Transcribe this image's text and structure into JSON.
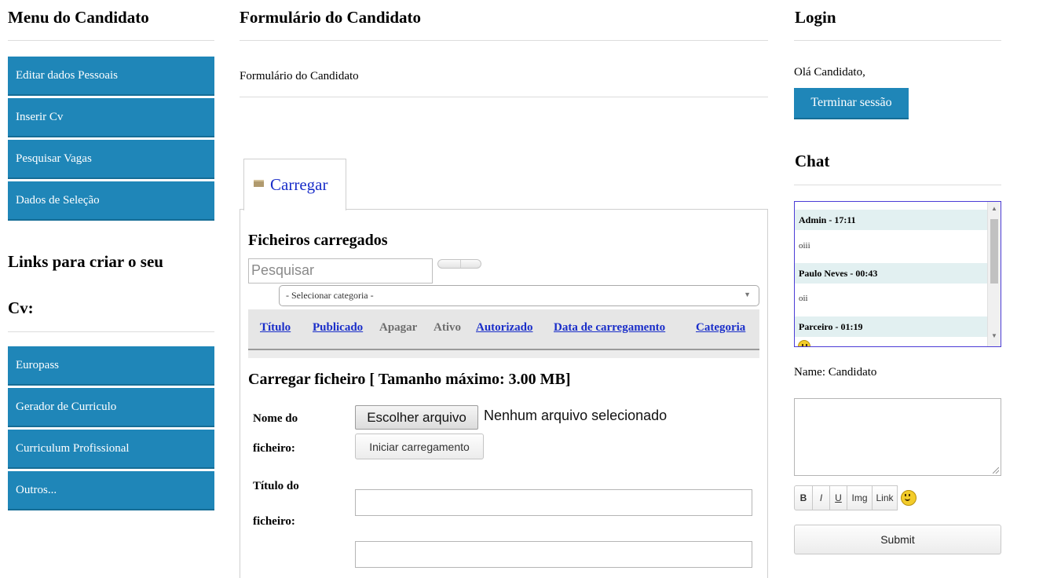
{
  "left": {
    "menu_title": "Menu do Candidato",
    "menu_items": [
      {
        "label": "Editar dados Pessoais"
      },
      {
        "label": "Inserir Cv"
      },
      {
        "label": "Pesquisar Vagas"
      },
      {
        "label": "Dados de Seleção"
      }
    ],
    "links_title_line1": "Links para criar o seu",
    "links_title_line2": "Cv:",
    "links": [
      {
        "label": "Europass"
      },
      {
        "label": "Gerador de Curriculo"
      },
      {
        "label": "Curriculum Profissional"
      },
      {
        "label": "Outros..."
      }
    ]
  },
  "main": {
    "title": "Formulário do Candidato",
    "subtitle": "Formulário do Candidato",
    "tab_label": "Carregar",
    "files_heading": "Ficheiros carregados",
    "search_placeholder": "Pesquisar",
    "category_select": "- Selecionar categoria -",
    "columns": [
      {
        "label": "Título"
      },
      {
        "label": "Publicado"
      },
      {
        "label": "Apagar"
      },
      {
        "label": "Ativo"
      },
      {
        "label": "Autorizado"
      },
      {
        "label": "Data de carregamento"
      },
      {
        "label": "Categoria"
      }
    ],
    "upload_heading": "Carregar ficheiro [ Tamanho máximo: 3.00 MB]",
    "file_name_label_1": "Nome do",
    "file_name_label_2": "ficheiro:",
    "choose_file_button": "Escolher arquivo",
    "no_file_text": "Nenhum arquivo selecionado",
    "start_upload_button": "Iniciar carregamento",
    "file_title_label_1": "Título do",
    "file_title_label_2": "ficheiro:"
  },
  "right": {
    "login_title": "Login",
    "greeting": "Olá Candidato,",
    "logout_button": "Terminar sessão",
    "chat_title": "Chat",
    "messages": [
      {
        "author": "Admin - 17:11",
        "text": "oiii"
      },
      {
        "author": "Paulo Neves - 00:43",
        "text": "oii"
      },
      {
        "author": "Parceiro - 01:19",
        "text": ""
      }
    ],
    "name_label": "Name: Candidato",
    "toolbar": {
      "bold": "B",
      "italic": "I",
      "underline": "U",
      "img": "Img",
      "link": "Link",
      "emoji": "smiley-icon"
    },
    "submit_button": "Submit"
  },
  "colors": {
    "menu_blue": "#1f86b8",
    "link_blue": "#1a2ec9",
    "chat_border": "#4b3cd6"
  }
}
